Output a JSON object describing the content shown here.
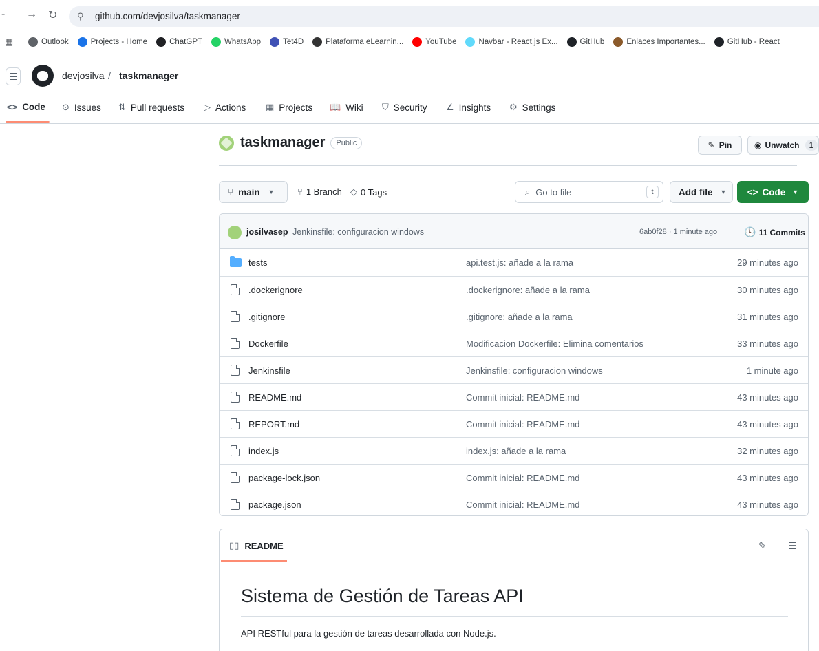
{
  "browser": {
    "url": "github.com/devjosilva/taskmanager",
    "bookmarks": [
      {
        "label": "Outlook",
        "color": "#5f6368"
      },
      {
        "label": "Projects - Home",
        "color": "#1a73e8"
      },
      {
        "label": "ChatGPT",
        "color": "#202124"
      },
      {
        "label": "WhatsApp",
        "color": "#25d366"
      },
      {
        "label": "Tet4D",
        "color": "#3f51b5"
      },
      {
        "label": "Plataforma eLearnin...",
        "color": "#333333"
      },
      {
        "label": "YouTube",
        "color": "#ff0000"
      },
      {
        "label": "Navbar - React.js Ex...",
        "color": "#61dafb"
      },
      {
        "label": "GitHub",
        "color": "#1f2328"
      },
      {
        "label": "Enlaces Importantes...",
        "color": "#8b5a2b"
      },
      {
        "label": "GitHub - React",
        "color": "#1f2328"
      }
    ]
  },
  "header": {
    "owner": "devjosilva",
    "separator": "/",
    "repo": "taskmanager"
  },
  "repo_nav": [
    {
      "label": "Code",
      "icon": "<>"
    },
    {
      "label": "Issues",
      "icon": "⊙"
    },
    {
      "label": "Pull requests",
      "icon": "⇅"
    },
    {
      "label": "Actions",
      "icon": "▷"
    },
    {
      "label": "Projects",
      "icon": "▦"
    },
    {
      "label": "Wiki",
      "icon": "📖"
    },
    {
      "label": "Security",
      "icon": "⛉"
    },
    {
      "label": "Insights",
      "icon": "∠"
    },
    {
      "label": "Settings",
      "icon": "⚙"
    }
  ],
  "repo": {
    "name": "taskmanager",
    "visibility": "Public",
    "pin_label": "Pin",
    "watch_label": "Unwatch",
    "watch_count": "1"
  },
  "toolbar": {
    "branch": "main",
    "branches": "1 Branch",
    "tags": "0 Tags",
    "goto_placeholder": "Go to file",
    "goto_key": "t",
    "add_file": "Add file",
    "code": "Code"
  },
  "latest_commit": {
    "author": "josilvasep",
    "message": "Jenkinsfile: configuracion windows",
    "meta": "6ab0f28 · 1 minute ago",
    "commits": "11 Commits"
  },
  "files": [
    {
      "name": "tests",
      "type": "folder",
      "message": "api.test.js: añade a la rama",
      "time": "29 minutes ago"
    },
    {
      "name": ".dockerignore",
      "type": "file",
      "message": ".dockerignore: añade a la rama",
      "time": "30 minutes ago"
    },
    {
      "name": ".gitignore",
      "type": "file",
      "message": ".gitignore: añade a la rama",
      "time": "31 minutes ago"
    },
    {
      "name": "Dockerfile",
      "type": "file",
      "message": "Modificacion Dockerfile: Elimina comentarios",
      "time": "33 minutes ago"
    },
    {
      "name": "Jenkinsfile",
      "type": "file",
      "message": "Jenkinsfile: configuracion windows",
      "time": "1 minute ago"
    },
    {
      "name": "README.md",
      "type": "file",
      "message": "Commit inicial: README.md",
      "time": "43 minutes ago"
    },
    {
      "name": "REPORT.md",
      "type": "file",
      "message": "Commit inicial: README.md",
      "time": "43 minutes ago"
    },
    {
      "name": "index.js",
      "type": "file",
      "message": "index.js: añade a la rama",
      "time": "32 minutes ago"
    },
    {
      "name": "package-lock.json",
      "type": "file",
      "message": "Commit inicial: README.md",
      "time": "43 minutes ago"
    },
    {
      "name": "package.json",
      "type": "file",
      "message": "Commit inicial: README.md",
      "time": "43 minutes ago"
    }
  ],
  "readme": {
    "tab": "README",
    "title": "Sistema de Gestión de Tareas API",
    "description": "API RESTful para la gestión de tareas desarrollada con Node.js."
  },
  "colors": {
    "accent_green": "#1f883d",
    "tab_underline": "#fd8c73",
    "folder_blue": "#54aeff"
  }
}
